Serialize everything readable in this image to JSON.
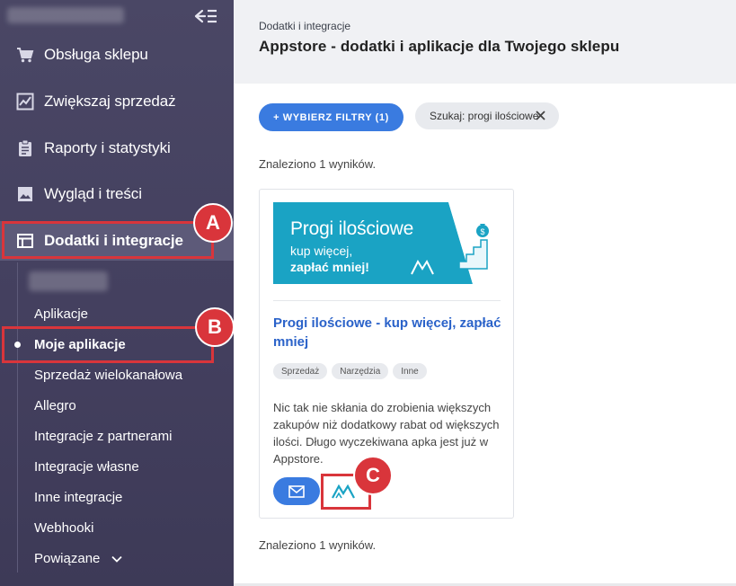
{
  "sidebar": {
    "items": [
      {
        "label": "Obsługa sklepu",
        "icon": "cart-icon"
      },
      {
        "label": "Zwiększaj sprzedaż",
        "icon": "chart-icon"
      },
      {
        "label": "Raporty i statystyki",
        "icon": "clipboard-icon"
      },
      {
        "label": "Wygląd i treści",
        "icon": "image-icon"
      },
      {
        "label": "Dodatki i integracje",
        "icon": "window-icon",
        "active": true
      }
    ],
    "sub_items": [
      {
        "label": "Aplikacje"
      },
      {
        "label": "Moje aplikacje",
        "active": true
      },
      {
        "label": "Sprzedaż wielokanałowa"
      },
      {
        "label": "Allegro"
      },
      {
        "label": "Integracje z partnerami"
      },
      {
        "label": "Integracje własne"
      },
      {
        "label": "Inne integracje"
      },
      {
        "label": "Webhooki"
      },
      {
        "label": "Powiązane"
      }
    ]
  },
  "header": {
    "breadcrumb": "Dodatki i integracje",
    "title": "Appstore - dodatki i aplikacje dla Twojego sklepu"
  },
  "filters": {
    "button_label": "+ WYBIERZ FILTRY (1)",
    "chip_label": "Szukaj: progi ilościowe"
  },
  "results": {
    "found_text": "Znaleziono 1 wyników."
  },
  "card": {
    "banner": {
      "line1": "Progi ilościowe",
      "line2": "kup więcej,",
      "line3": "zapłać mniej!"
    },
    "title": "Progi ilościowe - kup więcej, zapłać mniej",
    "tags": [
      "Sprzedaż",
      "Narzędzia",
      "Inne"
    ],
    "description": "Nic tak nie skłania do zrobienia większych zakupów niż dodatkowy rabat od większych ilości. Długo wyczekiwana apka jest już w Appstore."
  },
  "annotations": {
    "a": "A",
    "b": "B",
    "c": "C"
  },
  "colors": {
    "sidebar": "#433f5e",
    "accent": "#3a7be0",
    "banner": "#1aa3c4",
    "highlight": "#d9353b"
  }
}
